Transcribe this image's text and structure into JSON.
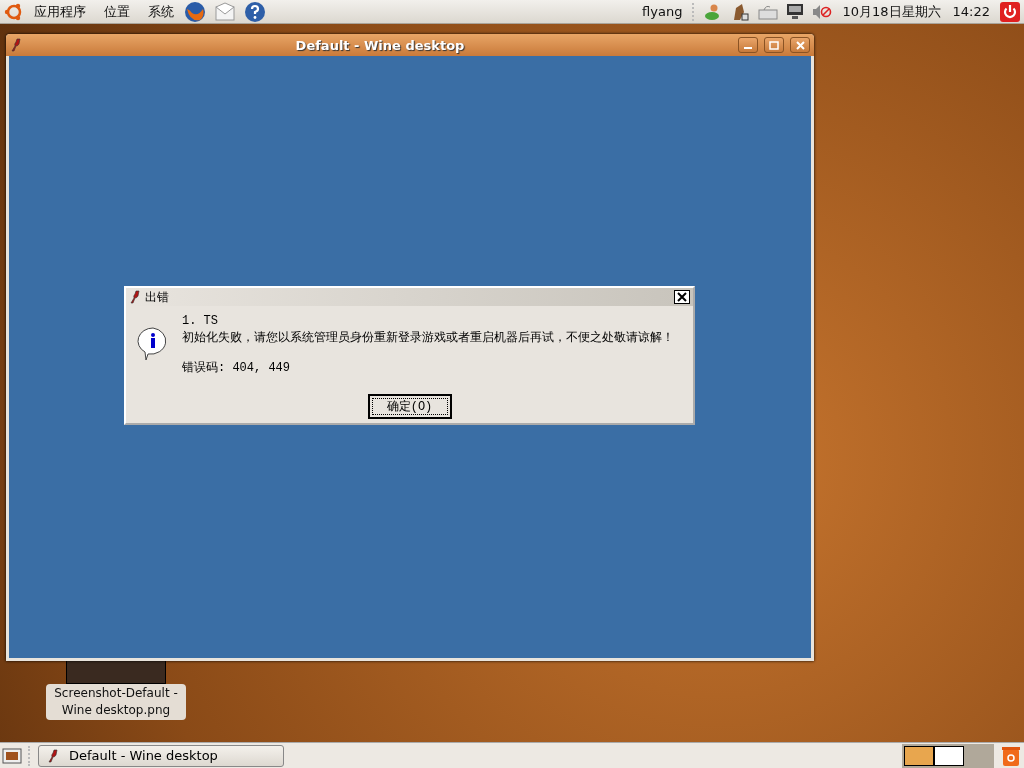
{
  "top_panel": {
    "menus": [
      "应用程序",
      "位置",
      "系统"
    ],
    "user": "flyang",
    "date": "10月18日星期六",
    "time": "14:22"
  },
  "window": {
    "title": "Default - Wine desktop"
  },
  "dialog": {
    "title": "出错",
    "lines": [
      "1. TS",
      "初始化失败，请您以系统管理员身份重新登录游戏或者重启机器后再试，不便之处敬请谅解！",
      "错误码: 404, 449"
    ],
    "button": "确定(O)"
  },
  "desktop_icon": {
    "label": "Screenshot-Default - Wine desktop.png"
  },
  "bottom_panel": {
    "tasks": [
      {
        "label": "Default - Wine desktop",
        "selected": false
      }
    ],
    "workspaces": [
      {
        "selected": true
      },
      {
        "selected": false
      }
    ]
  }
}
